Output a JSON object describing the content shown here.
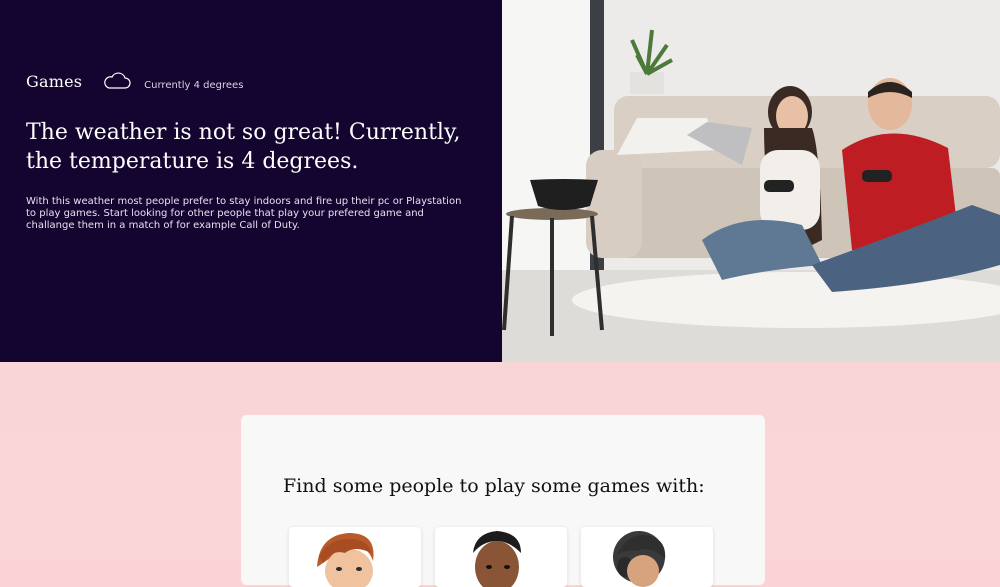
{
  "hero": {
    "brand": "Games",
    "weather_icon": "cloud-icon",
    "temperature_note": "Currently 4 degrees",
    "headline": "The weather is not so great! Currently, the temperature is 4 degrees.",
    "description": "With this weather most people prefer to stay indoors and fire up their pc or Playstation to play games. Start looking for other people that play your prefered game and challange them in a match of for example Call of Duty.",
    "background_color": "#13052f"
  },
  "section": {
    "title": "Find some people to play some games with:",
    "players": [
      {
        "avatar": "redhead-avatar"
      },
      {
        "avatar": "dark-hair-avatar"
      },
      {
        "avatar": "helmet-hair-avatar"
      }
    ]
  }
}
